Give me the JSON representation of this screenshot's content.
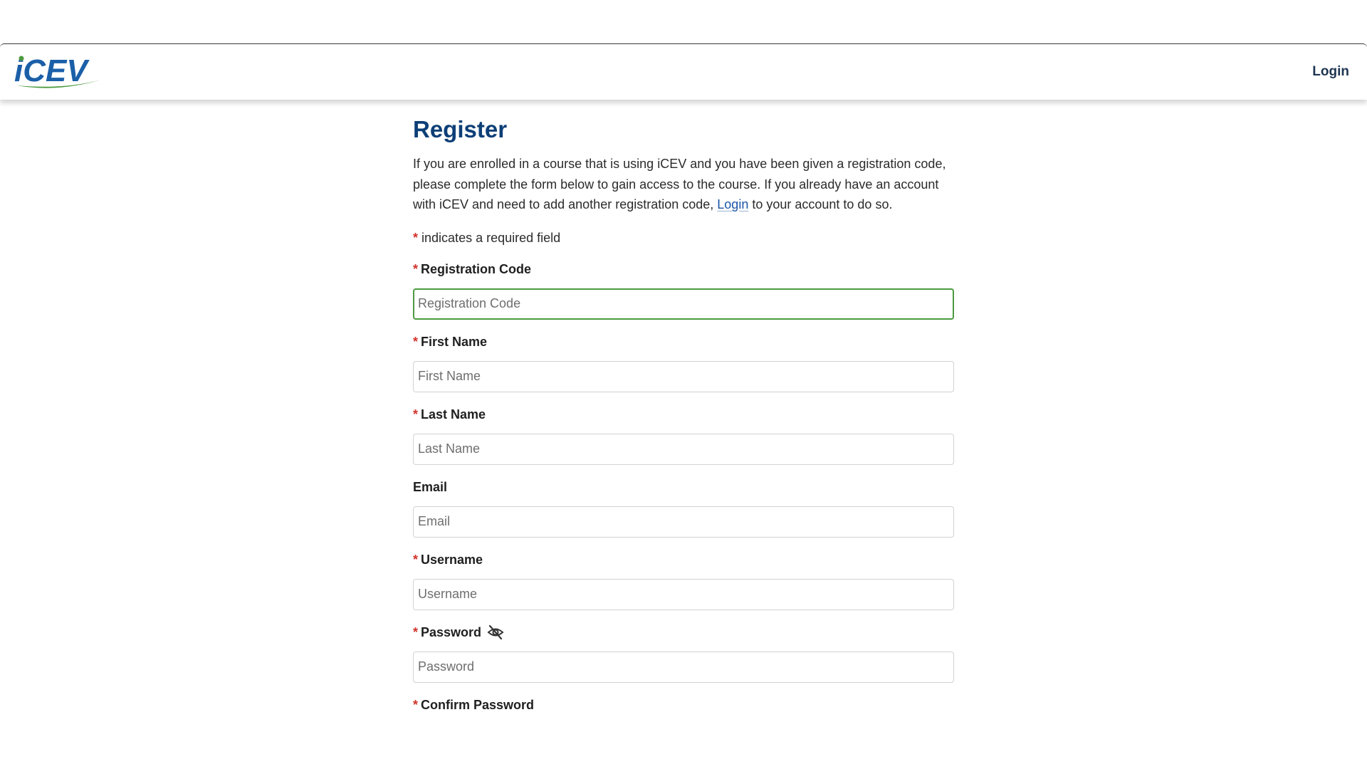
{
  "header": {
    "logo_text": "iCEV",
    "login_label": "Login"
  },
  "main": {
    "title": "Register",
    "intro_before": "If you are enrolled in a course that is using iCEV and you have been given a registration code, please complete the form below to gain access to the course. If you already have an account with iCEV and need to add another registration code, ",
    "intro_link": "Login",
    "intro_after": " to your account to do so.",
    "required_note": "indicates a required field",
    "required_marker": "*"
  },
  "form": {
    "registration_code": {
      "label": "Registration Code",
      "placeholder": "Registration Code",
      "value": "",
      "required": true
    },
    "first_name": {
      "label": "First Name",
      "placeholder": "First Name",
      "value": "",
      "required": true
    },
    "last_name": {
      "label": "Last Name",
      "placeholder": "Last Name",
      "value": "",
      "required": true
    },
    "email": {
      "label": "Email",
      "placeholder": "Email",
      "value": "",
      "required": false
    },
    "username": {
      "label": "Username",
      "placeholder": "Username",
      "value": "",
      "required": true
    },
    "password": {
      "label": "Password",
      "placeholder": "Password",
      "value": "",
      "required": true,
      "toggle_icon": "eye-slash-icon"
    },
    "confirm_password": {
      "label": "Confirm Password",
      "required": true
    }
  },
  "colors": {
    "brand_blue": "#0d3f77",
    "brand_green": "#4b9a3f",
    "required_red": "#d0342c",
    "link_blue": "#1a55a8"
  }
}
